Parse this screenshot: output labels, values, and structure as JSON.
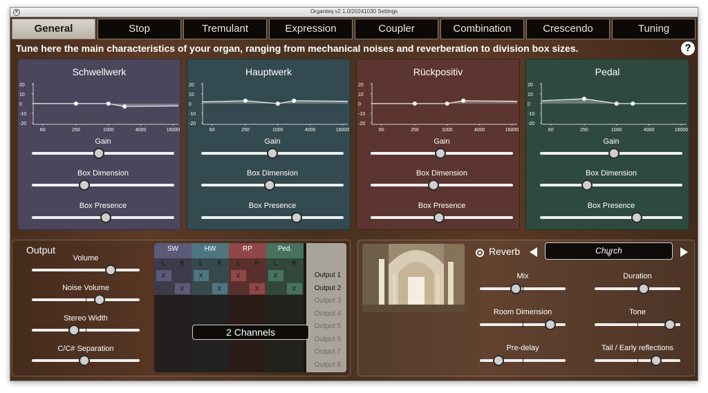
{
  "window": {
    "title": "Organteq v2.1.0/20241030 Settings"
  },
  "tabs": [
    {
      "label": "General",
      "active": true
    },
    {
      "label": "Stop"
    },
    {
      "label": "Tremulant"
    },
    {
      "label": "Expression"
    },
    {
      "label": "Coupler"
    },
    {
      "label": "Combination"
    },
    {
      "label": "Crescendo"
    },
    {
      "label": "Tuning"
    }
  ],
  "subtitle": "Tune here the main characteristics of your organ, ranging from mechanical noises and reverberation to division box sizes.",
  "help_label": "?",
  "eq_axis": {
    "y_ticks": [
      "20",
      "10",
      "0",
      "-10",
      "-20"
    ],
    "x_ticks": [
      "60",
      "250",
      "1000",
      "4000",
      "16000"
    ]
  },
  "divisions": [
    {
      "name": "Schwellwerk",
      "color": "#4b465c",
      "eq_points_db": [
        0,
        0,
        -3
      ],
      "gain_label": "Gain",
      "gain": 0.47,
      "box_dimension_label": "Box Dimension",
      "box_dimension": 0.37,
      "box_presence_label": "Box Presence",
      "box_presence": 0.52
    },
    {
      "name": "Hauptwerk",
      "color": "#334a50",
      "eq_points_db": [
        3,
        0,
        3
      ],
      "gain_label": "Gain",
      "gain": 0.5,
      "box_dimension_label": "Box Dimension",
      "box_dimension": 0.48,
      "box_presence_label": "Box Presence",
      "box_presence": 0.67
    },
    {
      "name": "Rückpositiv",
      "color": "#5c3530",
      "eq_points_db": [
        0,
        0,
        3
      ],
      "gain_label": "Gain",
      "gain": 0.49,
      "box_dimension_label": "Box Dimension",
      "box_dimension": 0.44,
      "box_presence_label": "Box Presence",
      "box_presence": 0.48
    },
    {
      "name": "Pedal",
      "color": "#2e4a3e",
      "eq_points_db": [
        5,
        0,
        0
      ],
      "gain_label": "Gain",
      "gain": 0.52,
      "box_dimension_label": "Box Dimension",
      "box_dimension": 0.33,
      "box_presence_label": "Box Presence",
      "box_presence": 0.68
    }
  ],
  "output": {
    "title": "Output",
    "volume_label": "Volume",
    "volume": 0.73,
    "noise_volume_label": "Noise Volume",
    "noise_volume": 0.63,
    "stereo_width_label": "Stereo Width",
    "stereo_width": 0.39,
    "separation_label": "C/C# Separation",
    "separation": 0.49,
    "routing": {
      "groups": [
        {
          "name": "SW",
          "color": "#5d5978"
        },
        {
          "name": "HW",
          "color": "#4f7680"
        },
        {
          "name": "RP",
          "color": "#8f4747"
        },
        {
          "name": "Ped.",
          "color": "#46725e"
        }
      ],
      "lr": [
        "L",
        "R"
      ],
      "mark": "X",
      "outputs": [
        "Output 1",
        "Output 2",
        "Output 3",
        "Output 4",
        "Output 5",
        "Output 6",
        "Output 7",
        "Output 8"
      ],
      "active_outputs": 2,
      "matrix": [
        [
          1,
          0,
          1,
          0,
          1,
          0,
          1,
          0
        ],
        [
          0,
          1,
          0,
          1,
          0,
          1,
          0,
          1
        ]
      ],
      "channels_label": "2 Channels"
    }
  },
  "reverb": {
    "label": "Reverb",
    "enabled": true,
    "room": "Church",
    "mix_label": "Mix",
    "mix": 0.42,
    "duration_label": "Duration",
    "duration": 0.57,
    "room_dimension_label": "Room Dimension",
    "room_dimension": 0.82,
    "tone_label": "Tone",
    "tone": 0.88,
    "pre_delay_label": "Pre-delay",
    "pre_delay": 0.22,
    "tail_label": "Tail / Early reflections",
    "tail": 0.72
  }
}
